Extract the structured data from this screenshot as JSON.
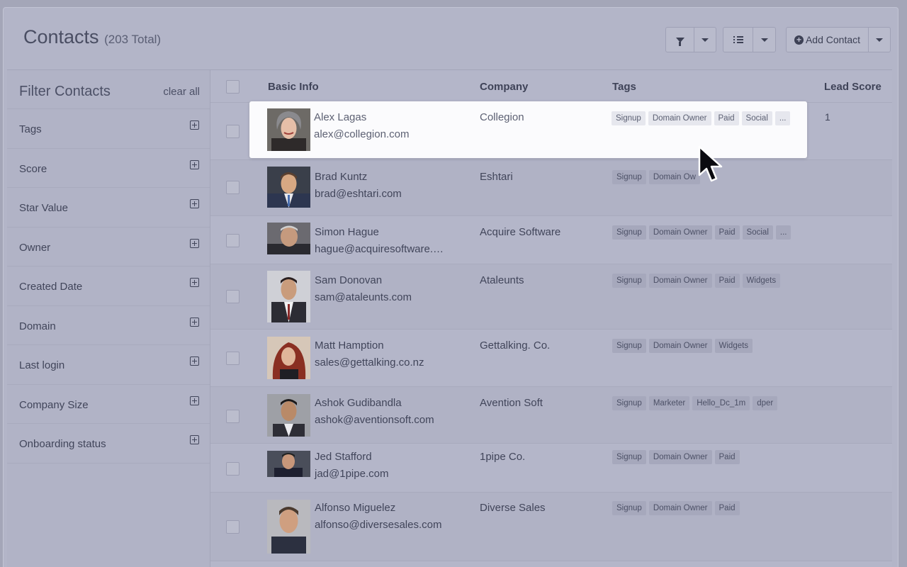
{
  "header": {
    "title": "Contacts",
    "total": "(203 Total)",
    "add_contact_label": "Add Contact"
  },
  "sidebar": {
    "title": "Filter Contacts",
    "clear_label": "clear all",
    "items": [
      {
        "label": "Tags"
      },
      {
        "label": "Score"
      },
      {
        "label": "Star Value"
      },
      {
        "label": "Owner"
      },
      {
        "label": "Created Date"
      },
      {
        "label": "Domain"
      },
      {
        "label": "Last login"
      },
      {
        "label": "Company Size"
      },
      {
        "label": "Onboarding status"
      }
    ]
  },
  "table": {
    "columns": [
      "Basic Info",
      "Company",
      "Tags",
      "Lead Score"
    ],
    "rows": [
      {
        "name": "Alex Lagas",
        "email": "alex@collegion.com",
        "company": "Collegion",
        "tags": [
          "Signup",
          "Domain Owner",
          "Paid",
          "Social",
          "..."
        ],
        "score": "1"
      },
      {
        "name": "Brad Kuntz",
        "email": "brad@eshtari.com",
        "company": "Eshtari",
        "tags": [
          "Signup",
          "Domain Ow"
        ],
        "score": ""
      },
      {
        "name": "Simon Hague",
        "email": "hague@acquiresoftware.…",
        "company": "Acquire Software",
        "tags": [
          "Signup",
          "Domain Owner",
          "Paid",
          "Social",
          "..."
        ],
        "score": ""
      },
      {
        "name": "Sam Donovan",
        "email": "sam@ataleunts.com",
        "company": "Ataleunts",
        "tags": [
          "Signup",
          "Domain Owner",
          "Paid",
          "Widgets"
        ],
        "score": ""
      },
      {
        "name": "Matt Hamption",
        "email": "sales@gettalking.co.nz",
        "company": "Gettalking. Co.",
        "tags": [
          "Signup",
          "Domain Owner",
          "Widgets"
        ],
        "score": ""
      },
      {
        "name": "Ashok Gudibandla",
        "email": "ashok@aventionsoft.com",
        "company": "Avention Soft",
        "tags": [
          "Signup",
          "Marketer",
          "Hello_Dc_1m",
          "dper"
        ],
        "score": ""
      },
      {
        "name": "Jed Stafford",
        "email": "jad@1pipe.com",
        "company": "1pipe Co.",
        "tags": [
          "Signup",
          "Domain Owner",
          "Paid"
        ],
        "score": ""
      },
      {
        "name": "Alfonso Miguelez",
        "email": "alfonso@diversesales.com",
        "company": "Diverse Sales",
        "tags": [
          "Signup",
          "Domain Owner",
          "Paid"
        ],
        "score": ""
      }
    ]
  },
  "icons": [
    "filter-icon",
    "list-view-icon",
    "chevron-down-icon",
    "plus-circle-icon",
    "expand-icon",
    "mouse-cursor-icon"
  ],
  "colors": {
    "overlay_bg": "#b3b5c8",
    "highlight_bg": "#fbfbfd"
  }
}
